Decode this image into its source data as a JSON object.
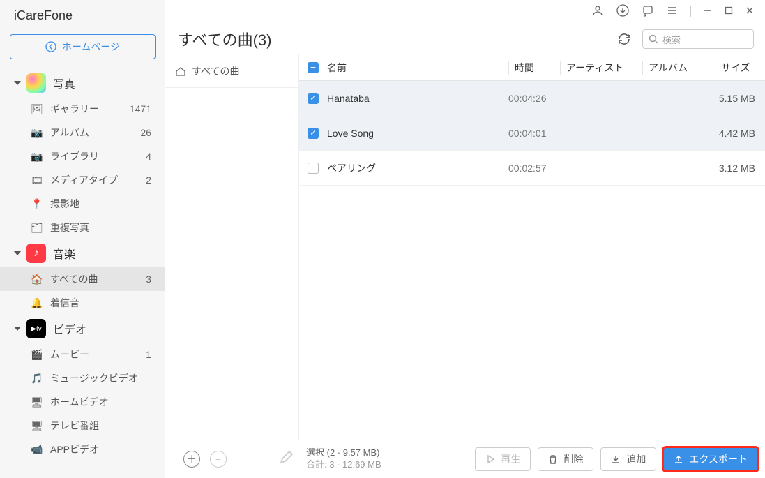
{
  "app": {
    "title": "iCareFone",
    "home_btn": "ホームページ"
  },
  "sidebar": {
    "photos": {
      "label": "写真",
      "items": [
        {
          "icon": "🖼",
          "label": "ギャラリー",
          "count": "1471"
        },
        {
          "icon": "📷",
          "label": "アルバム",
          "count": "26"
        },
        {
          "icon": "📷",
          "label": "ライブラリ",
          "count": "4"
        },
        {
          "icon": "🎞",
          "label": "メディアタイプ",
          "count": "2"
        },
        {
          "icon": "📍",
          "label": "撮影地",
          "count": ""
        },
        {
          "icon": "🗂",
          "label": "重複写真",
          "count": ""
        }
      ]
    },
    "music": {
      "label": "音楽",
      "items": [
        {
          "icon": "🏠",
          "label": "すべての曲",
          "count": "3",
          "active": true
        },
        {
          "icon": "🔔",
          "label": "着信音",
          "count": ""
        }
      ]
    },
    "video": {
      "label": "ビデオ",
      "badge": "▶tv",
      "items": [
        {
          "icon": "🎬",
          "label": "ムービー",
          "count": "1"
        },
        {
          "icon": "🎵",
          "label": "ミュージックビデオ",
          "count": ""
        },
        {
          "icon": "🖥",
          "label": "ホームビデオ",
          "count": ""
        },
        {
          "icon": "🖥",
          "label": "テレビ番組",
          "count": ""
        },
        {
          "icon": "📹",
          "label": "APPビデオ",
          "count": ""
        }
      ]
    }
  },
  "header": {
    "title": "すべての曲(3)",
    "search_placeholder": "検索"
  },
  "subnav": {
    "all_songs": "すべての曲"
  },
  "table": {
    "cols": {
      "name": "名前",
      "time": "時間",
      "artist": "アーティスト",
      "album": "アルバム",
      "size": "サイズ"
    },
    "rows": [
      {
        "checked": true,
        "name": "Hanataba",
        "time": "00:04:26",
        "size": "5.15 MB"
      },
      {
        "checked": true,
        "name": "Love Song",
        "time": "00:04:01",
        "size": "4.42 MB"
      },
      {
        "checked": false,
        "name": "ペアリング",
        "time": "00:02:57",
        "size": "3.12 MB"
      }
    ]
  },
  "footer": {
    "selection": "選択 (2 · 9.57 MB)",
    "total": "合計: 3 · 12.69 MB",
    "play": "再生",
    "delete": "削除",
    "add": "追加",
    "export": "エクスポート"
  }
}
